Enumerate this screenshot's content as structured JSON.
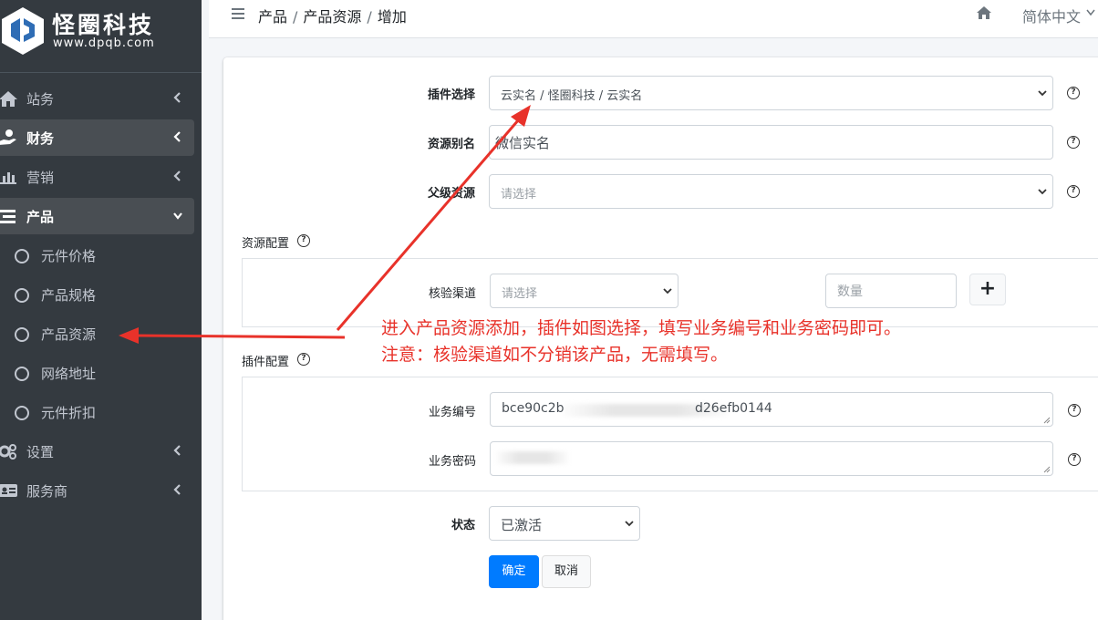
{
  "brand": {
    "name": "怪圈科技",
    "url": "www.dpqb.com"
  },
  "sidebar": {
    "items": [
      {
        "label": "站务",
        "icon": "home-icon",
        "active": false
      },
      {
        "label": "财务",
        "icon": "hand-money-icon",
        "active": true
      },
      {
        "label": "营销",
        "icon": "bar-chart-icon",
        "active": false
      },
      {
        "label": "产品",
        "icon": "list-icon",
        "active": true,
        "expanded": true
      }
    ],
    "sub_items": [
      {
        "label": "元件价格"
      },
      {
        "label": "产品规格"
      },
      {
        "label": "产品资源"
      },
      {
        "label": "网络地址"
      },
      {
        "label": "元件折扣"
      }
    ],
    "bottom_items": [
      {
        "label": "设置",
        "icon": "gears-icon"
      },
      {
        "label": "服务商",
        "icon": "id-card-icon"
      }
    ]
  },
  "topbar": {
    "breadcrumb": [
      "产品",
      "产品资源",
      "增加"
    ],
    "language": "简体中文"
  },
  "form": {
    "plugin_select": {
      "label": "插件选择",
      "value": "云实名 / 怪圈科技 / 云实名"
    },
    "alias": {
      "label": "资源别名",
      "value": "微信实名"
    },
    "parent": {
      "label": "父级资源",
      "placeholder": "请选择"
    },
    "resource_config": {
      "title": "资源配置",
      "channel_label": "核验渠道",
      "channel_placeholder": "请选择",
      "quantity_placeholder": "数量",
      "add_label": "+"
    },
    "plugin_config": {
      "title": "插件配置",
      "biz_no_label": "业务编号",
      "biz_no_value_start": "bce90c2b",
      "biz_no_value_end": "d26efb0144",
      "biz_pwd_label": "业务密码"
    },
    "status": {
      "label": "状态",
      "value": "已激活"
    },
    "confirm": "确定",
    "cancel": "取消",
    "help_glyph": "?"
  },
  "annotation": {
    "line1": "进入产品资源添加，插件如图选择，填写业务编号和业务密码即可。",
    "line2": "注意：核验渠道如不分销该产品，无需填写。",
    "color": "#e8322a"
  }
}
